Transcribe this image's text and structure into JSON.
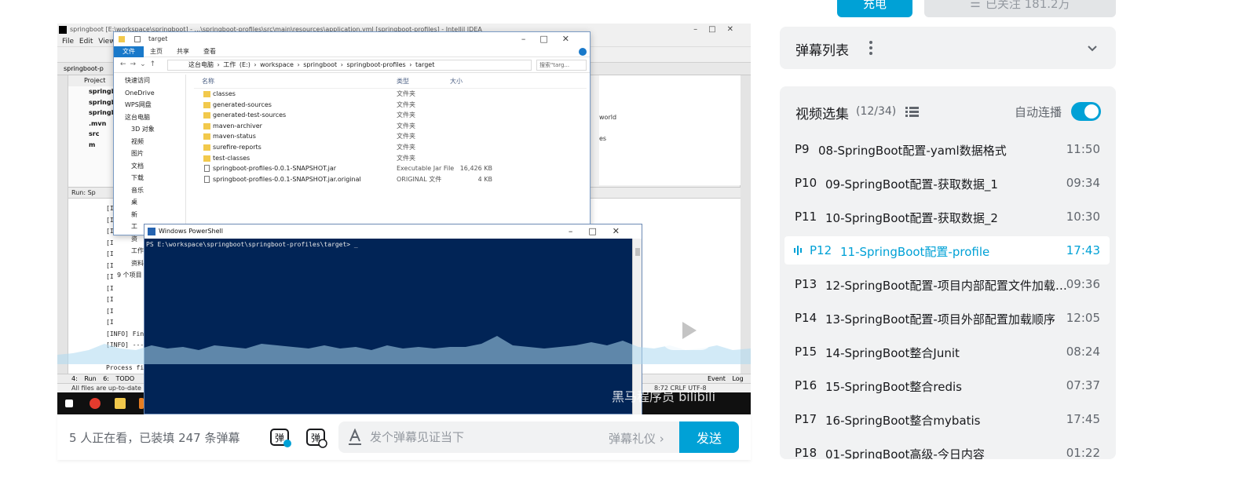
{
  "top": {
    "charge_label": "充电",
    "follow_label": "已关注 181.2万"
  },
  "ide": {
    "title": "springboot [E:\\workspace\\springboot] - ...\\springboot-profiles\\src\\main\\resources\\application.yml [springboot-profiles] - IntelliJ IDEA",
    "menu": "File Edit View",
    "project_tab": "springboot-p",
    "project_label": "Project",
    "project_rows": [
      "springb",
      "springb",
      "springb",
      ".mvn",
      "src",
      "m"
    ],
    "editor_lines": [
      "world",
      "es"
    ],
    "run_label": "Run:",
    "run_tab": "Sp",
    "run_lines": [
      "[I",
      "[I",
      "[I",
      "[I",
      "[I",
      "[I",
      "[I",
      "[I",
      "[I",
      "[I",
      "[I",
      "[INFO] Fin",
      "[INFO] ---",
      "",
      "Process fi"
    ],
    "bottom_tabs": "4: Run   6: TODO",
    "event_log": "Event Log",
    "status": "All files are up-to-date (",
    "status_right": "8:72  CRLF  UTF-8"
  },
  "explorer": {
    "title": "target",
    "ribbon": [
      "文件",
      "主页",
      "共享",
      "查看"
    ],
    "path": [
      "这台电脑",
      "工作 (E:)",
      "workspace",
      "springboot",
      "springboot-profiles",
      "target"
    ],
    "search_placeholder": "搜索\"targ...",
    "nav": [
      "快速访问",
      "OneDrive",
      "WPS网盘",
      "这台电脑",
      "3D 对象",
      "视频",
      "图片",
      "文档",
      "下载",
      "音乐",
      "桌",
      "新",
      "工",
      "资",
      "工作",
      "资料"
    ],
    "nav_footer": "9 个项目",
    "headers": {
      "name": "名称",
      "type": "类型",
      "size": "大小"
    },
    "files": [
      {
        "name": "classes",
        "type": "文件夹",
        "size": ""
      },
      {
        "name": "generated-sources",
        "type": "文件夹",
        "size": ""
      },
      {
        "name": "generated-test-sources",
        "type": "文件夹",
        "size": ""
      },
      {
        "name": "maven-archiver",
        "type": "文件夹",
        "size": ""
      },
      {
        "name": "maven-status",
        "type": "文件夹",
        "size": ""
      },
      {
        "name": "surefire-reports",
        "type": "文件夹",
        "size": ""
      },
      {
        "name": "test-classes",
        "type": "文件夹",
        "size": ""
      },
      {
        "name": "springboot-profiles-0.0.1-SNAPSHOT.jar",
        "type": "Executable Jar File",
        "size": "16,426 KB"
      },
      {
        "name": "springboot-profiles-0.0.1-SNAPSHOT.jar.original",
        "type": "ORIGINAL 文件",
        "size": "4 KB"
      }
    ]
  },
  "powershell": {
    "title": "Windows PowerShell",
    "prompt": "PS E:\\workspace\\springboot\\springboot-profiles\\target> _"
  },
  "watermark": "黑马程序员 bilibili",
  "sendbar": {
    "viewers": "5 人正在看，已装填 247 条弹幕",
    "placeholder": "发个弹幕见证当下",
    "etiquette": "弹幕礼仪 ›",
    "send_label": "发送"
  },
  "danmaku_list": {
    "label": "弹幕列表"
  },
  "collection": {
    "title": "视频选集",
    "count": "(12/34)",
    "autoplay_label": "自动连播",
    "autoplay_on": true,
    "episodes": [
      {
        "p": "P9",
        "title": "08-SpringBoot配置-yaml数据格式",
        "duration": "11:50",
        "active": false
      },
      {
        "p": "P10",
        "title": "09-SpringBoot配置-获取数据_1",
        "duration": "09:34",
        "active": false
      },
      {
        "p": "P11",
        "title": "10-SpringBoot配置-获取数据_2",
        "duration": "10:30",
        "active": false
      },
      {
        "p": "P12",
        "title": "11-SpringBoot配置-profile",
        "duration": "17:43",
        "active": true
      },
      {
        "p": "P13",
        "title": "12-SpringBoot配置-项目内部配置文件加载顺序",
        "duration": "09:36",
        "active": false
      },
      {
        "p": "P14",
        "title": "13-SpringBoot配置-项目外部配置加载顺序",
        "duration": "12:05",
        "active": false
      },
      {
        "p": "P15",
        "title": "14-SpringBoot整合Junit",
        "duration": "08:24",
        "active": false
      },
      {
        "p": "P16",
        "title": "15-SpringBoot整合redis",
        "duration": "07:37",
        "active": false
      },
      {
        "p": "P17",
        "title": "16-SpringBoot整合mybatis",
        "duration": "17:45",
        "active": false
      },
      {
        "p": "P18",
        "title": "01-SpringBoot高级-今日内容",
        "duration": "01:22",
        "active": false
      }
    ]
  },
  "colors": {
    "accent": "#00a1d6",
    "panel_bg": "#f1f2f3",
    "powershell_bg": "#012456"
  }
}
